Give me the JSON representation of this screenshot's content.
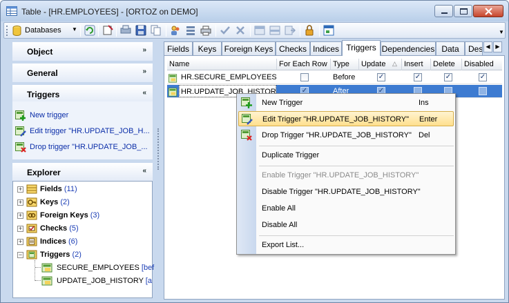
{
  "window": {
    "title": "Table - [HR.EMPLOYEES] - [ORTOZ on DEMO]"
  },
  "toolbar": {
    "databases_label": "Databases"
  },
  "left_panel": {
    "sections": [
      {
        "label": "Object",
        "state": "collapsed"
      },
      {
        "label": "General",
        "state": "collapsed"
      },
      {
        "label": "Triggers",
        "state": "expanded"
      }
    ],
    "trigger_links": [
      {
        "label": "New trigger",
        "icon": "add-trigger-icon"
      },
      {
        "label": "Edit trigger \"HR.UPDATE_JOB_H...",
        "icon": "edit-trigger-icon"
      },
      {
        "label": "Drop trigger \"HR.UPDATE_JOB_...",
        "icon": "drop-trigger-icon"
      }
    ],
    "explorer_label": "Explorer",
    "tree": [
      {
        "label": "Fields",
        "count": "(11)",
        "icon": "fields-icon"
      },
      {
        "label": "Keys",
        "count": "(2)",
        "icon": "keys-icon"
      },
      {
        "label": "Foreign Keys",
        "count": "(3)",
        "icon": "foreign-keys-icon"
      },
      {
        "label": "Checks",
        "count": "(5)",
        "icon": "checks-icon"
      },
      {
        "label": "Indices",
        "count": "(6)",
        "icon": "indices-icon"
      },
      {
        "label": "Triggers",
        "count": "(2)",
        "icon": "triggers-icon"
      }
    ],
    "tree_children": [
      {
        "label": "SECURE_EMPLOYEES",
        "suffix": "[bef",
        "icon": "trigger-icon"
      },
      {
        "label": "UPDATE_JOB_HISTORY",
        "suffix": "[a",
        "icon": "trigger-icon"
      }
    ]
  },
  "tabs": [
    "Fields",
    "Keys",
    "Foreign Keys",
    "Checks",
    "Indices",
    "Triggers",
    "Dependencies",
    "Data",
    "Des"
  ],
  "active_tab": "Triggers",
  "grid": {
    "columns": [
      "Name",
      "For Each Row",
      "Type",
      "Update",
      "Insert",
      "Delete",
      "Disabled"
    ],
    "rows": [
      {
        "name": "HR.SECURE_EMPLOYEES",
        "for_each_row": false,
        "type": "Before",
        "update": true,
        "insert": true,
        "delete": true,
        "disabled": true
      },
      {
        "name": "HR.UPDATE_JOB_HISTOR",
        "for_each_row": true,
        "type": "After",
        "update": true,
        "insert": false,
        "delete": false,
        "disabled": false
      }
    ]
  },
  "context_menu": {
    "items": [
      {
        "label": "New Trigger",
        "shortcut": "Ins",
        "icon": "add-trigger-icon"
      },
      {
        "label": "Edit Trigger \"HR.UPDATE_JOB_HISTORY\"",
        "shortcut": "Enter",
        "icon": "edit-trigger-icon"
      },
      {
        "label": "Drop Trigger \"HR.UPDATE_JOB_HISTORY\"",
        "shortcut": "Del",
        "icon": "drop-trigger-icon"
      },
      {
        "label": "Duplicate Trigger",
        "shortcut": ""
      },
      {
        "label": "Enable Trigger \"HR.UPDATE_JOB_HISTORY\"",
        "shortcut": "",
        "disabled": true
      },
      {
        "label": "Disable Trigger \"HR.UPDATE_JOB_HISTORY\"",
        "shortcut": ""
      },
      {
        "label": "Enable All",
        "shortcut": ""
      },
      {
        "label": "Disable All",
        "shortcut": ""
      },
      {
        "label": "Export List...",
        "shortcut": ""
      }
    ]
  }
}
